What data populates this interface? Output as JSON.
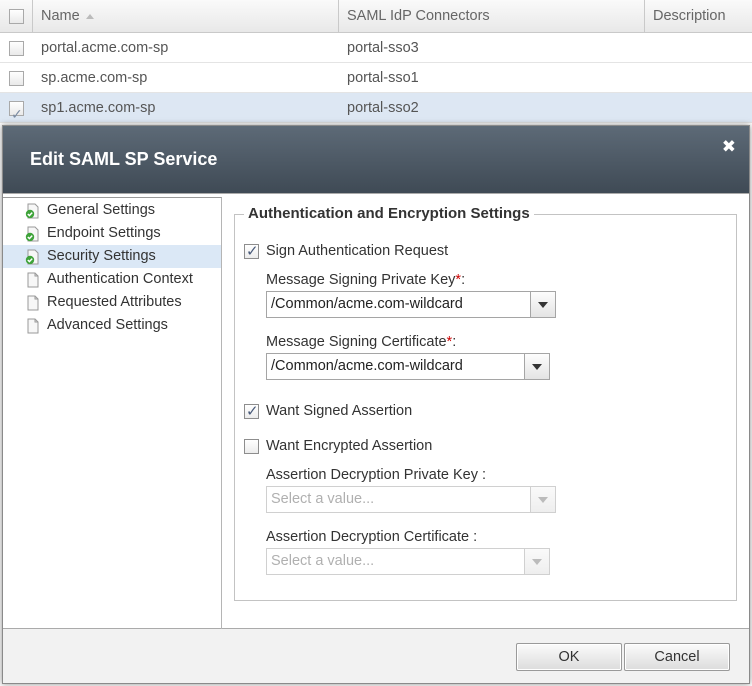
{
  "grid": {
    "columns": {
      "name": "Name",
      "idp": "SAML IdP Connectors",
      "description": "Description"
    },
    "rows": [
      {
        "name": "portal.acme.com-sp",
        "idp": "portal-sso3",
        "description": "",
        "checked": false
      },
      {
        "name": "sp.acme.com-sp",
        "idp": "portal-sso1",
        "description": "",
        "checked": false
      },
      {
        "name": "sp1.acme.com-sp",
        "idp": "portal-sso2",
        "description": "",
        "checked": true
      }
    ]
  },
  "dialog": {
    "title": "Edit SAML SP Service",
    "close_glyph": "✖",
    "nav": [
      {
        "label": "General Settings",
        "icon": "page-check-icon"
      },
      {
        "label": "Endpoint Settings",
        "icon": "page-check-icon"
      },
      {
        "label": "Security Settings",
        "icon": "page-check-icon"
      },
      {
        "label": "Authentication Context",
        "icon": "page-icon"
      },
      {
        "label": "Requested Attributes",
        "icon": "page-icon"
      },
      {
        "label": "Advanced Settings",
        "icon": "page-icon"
      }
    ],
    "section_title": "Authentication and Encryption Settings",
    "sign_auth_request": {
      "label": "Sign Authentication Request",
      "checked": true
    },
    "signing_key": {
      "label": "Message Signing Private Key",
      "required": "*",
      "suffix": ":",
      "value": "/Common/acme.com-wildcard"
    },
    "signing_cert": {
      "label": "Message Signing Certificate",
      "required": "*",
      "suffix": ":",
      "value": "/Common/acme.com-wildcard"
    },
    "want_signed": {
      "label": "Want Signed Assertion",
      "checked": true
    },
    "want_encrypted": {
      "label": "Want Encrypted Assertion",
      "checked": false
    },
    "decrypt_key": {
      "label": "Assertion Decryption Private Key",
      "suffix": " :",
      "placeholder": "Select a value..."
    },
    "decrypt_cert": {
      "label": "Assertion Decryption Certificate",
      "suffix": " :",
      "placeholder": "Select a value..."
    },
    "ok_label": "OK",
    "cancel_label": "Cancel"
  },
  "colors": {
    "title_bar": "#4e5a66",
    "nav_active": "#dbe8f6",
    "required": "#cc0000",
    "row_selected": "#dde7f3"
  }
}
